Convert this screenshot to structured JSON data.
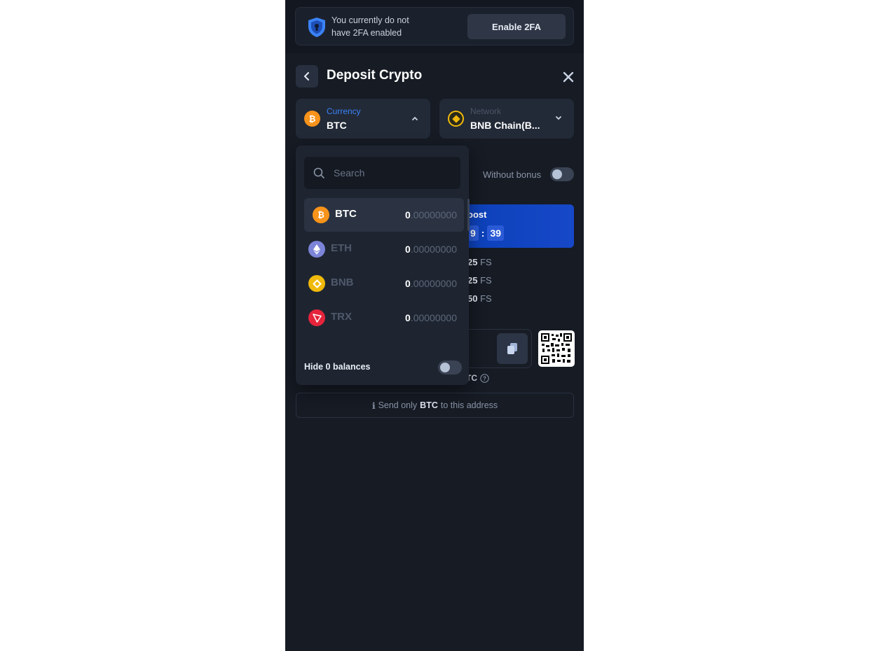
{
  "banner": {
    "message": "You currently do not have 2FA enabled",
    "enable_label": "Enable 2FA"
  },
  "header": {
    "title": "Deposit Crypto"
  },
  "currency_selector": {
    "label": "Currency",
    "value": "BTC"
  },
  "network_selector": {
    "label": "Network",
    "value": "BNB Chain(B..."
  },
  "bonus": {
    "toggle_label": "Without bonus",
    "boost_title": "oost",
    "timer": [
      "9",
      "39"
    ],
    "fs_lines": [
      {
        "amount": "25",
        "unit": "FS"
      },
      {
        "amount": "25",
        "unit": "FS"
      },
      {
        "amount": "50",
        "unit": "FS"
      }
    ]
  },
  "address": {
    "currency_note": "TC"
  },
  "send_note": {
    "prefix": "Send only",
    "currency": "BTC",
    "suffix": "to this address"
  },
  "dropdown": {
    "search_placeholder": "Search",
    "coins": [
      {
        "symbol": "BTC",
        "balance_int": "0",
        "balance_dec": ".00000000",
        "color": "#f7931a",
        "active": true
      },
      {
        "symbol": "ETH",
        "balance_int": "0",
        "balance_dec": ".00000000",
        "color": "#7b84d8",
        "active": false
      },
      {
        "symbol": "BNB",
        "balance_int": "0",
        "balance_dec": ".00000000",
        "color": "#f0b90b",
        "active": false
      },
      {
        "symbol": "TRX",
        "balance_int": "0",
        "balance_dec": ".00000000",
        "color": "#e5243b",
        "active": false
      }
    ],
    "hide_zero_label": "Hide 0 balances"
  },
  "colors": {
    "accent_blue": "#3b82f6",
    "panel": "#161b24"
  }
}
